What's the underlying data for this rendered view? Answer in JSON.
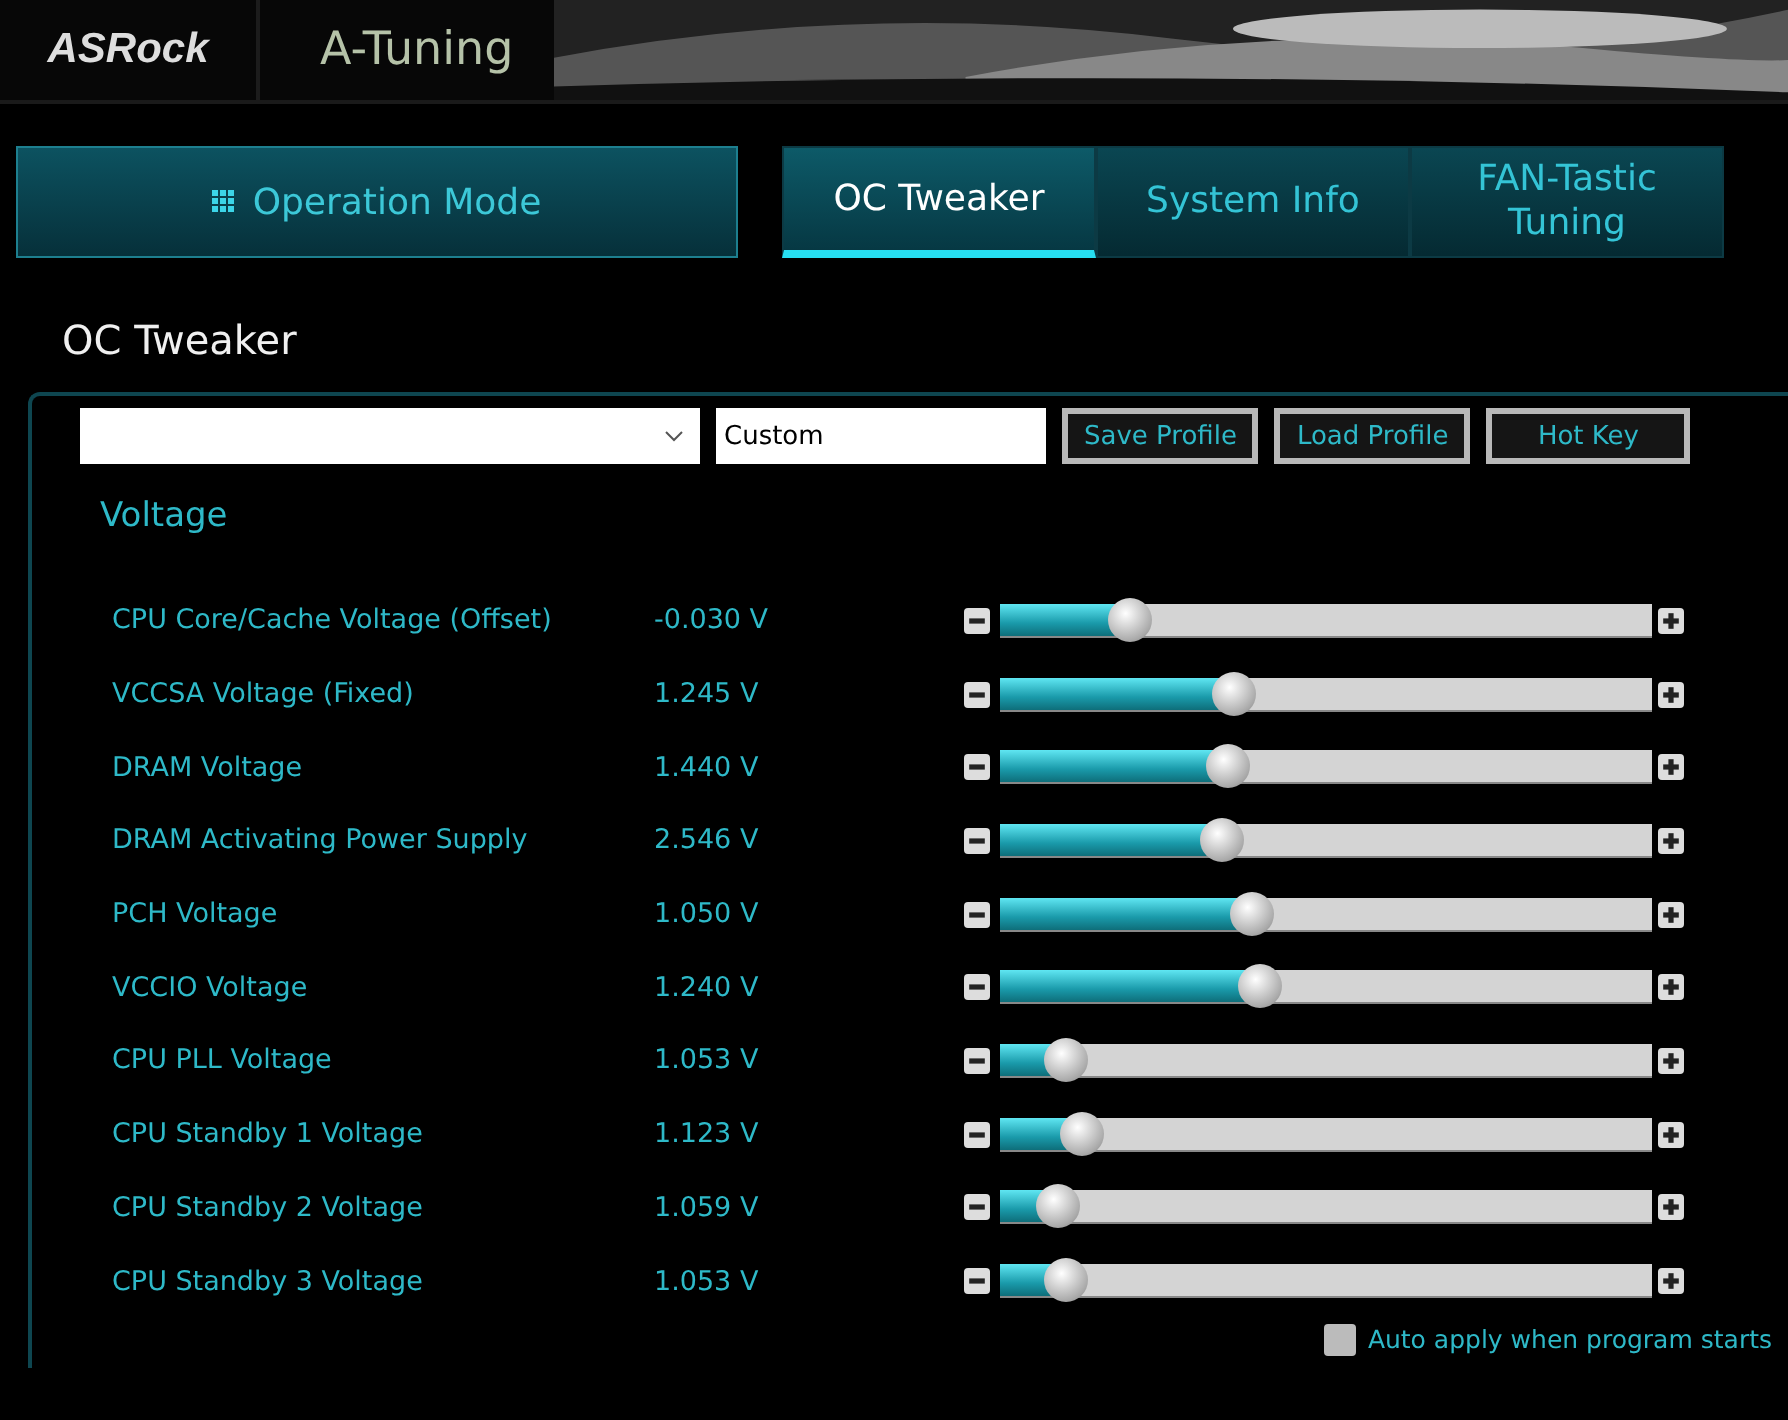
{
  "header": {
    "logo": "ASRock",
    "title": "A-Tuning"
  },
  "mode_button": {
    "label": "Operation Mode"
  },
  "tabs": [
    {
      "label": "OC Tweaker",
      "selected": true
    },
    {
      "label": "System Info",
      "selected": false
    },
    {
      "label": "FAN-Tastic Tuning",
      "selected": false
    }
  ],
  "page_title": "OC Tweaker",
  "profile": {
    "name": "Custom",
    "buttons": [
      "Save Profile",
      "Load Profile",
      "Hot Key"
    ]
  },
  "section": "Voltage",
  "voltages": [
    {
      "name": "CPU Core/Cache Voltage (Offset)",
      "reading": "-0.030 V",
      "level": 0.2
    },
    {
      "name": "VCCSA Voltage (Fixed)",
      "reading": "1.245 V",
      "level": 0.36
    },
    {
      "name": "DRAM Voltage",
      "reading": "1.440 V",
      "level": 0.35
    },
    {
      "name": "DRAM Activating Power Supply",
      "reading": "2.546 V",
      "level": 0.34
    },
    {
      "name": "PCH Voltage",
      "reading": "1.050 V",
      "level": 0.385
    },
    {
      "name": "VCCIO Voltage",
      "reading": "1.240 V",
      "level": 0.4
    },
    {
      "name": "CPU PLL Voltage",
      "reading": "1.053 V",
      "level": 0.1
    },
    {
      "name": "CPU Standby 1 Voltage",
      "reading": "1.123 V",
      "level": 0.125
    },
    {
      "name": "CPU Standby 2 Voltage",
      "reading": "1.059 V",
      "level": 0.09
    },
    {
      "name": "CPU Standby 3 Voltage",
      "reading": "1.053 V",
      "level": 0.1
    }
  ],
  "auto_apply": {
    "label": "Auto apply when program starts",
    "checked": false
  }
}
